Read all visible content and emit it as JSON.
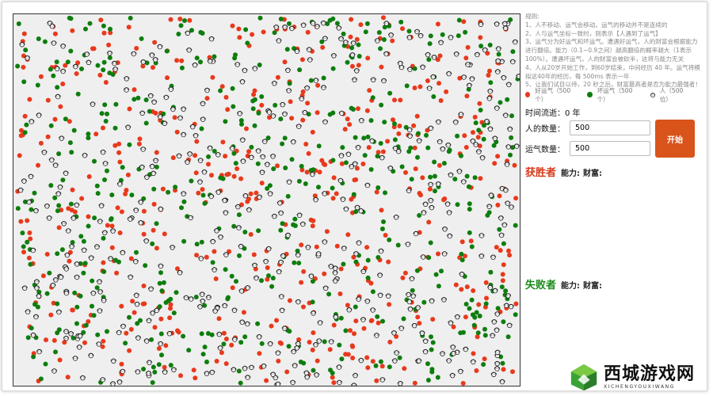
{
  "rules": {
    "title": "规则:",
    "lines": [
      "1、人不移动、运气会移动。运气的移动并不是连续的",
      "2、人与运气坐标一致时，则表示【人遇到了运气】",
      "3、运气分为好运气和坏运气。遭遇好运气，人的财富会根据能力",
      "进行翻倍。能力（0.1~0.9之间）越高翻倍的概率越大（1表示",
      "100%）。遭遇坏运气，人的财富会被砍半，这将与能力无关",
      "4、人从20岁开始工作，到60岁结束，中间经历 40 年。运气将模",
      "拟这40年的经历，每 500ms 表示一年",
      "5、让我们试目以待，20 秒之后，财富最高者是否为能力最强者！"
    ]
  },
  "legend": {
    "good_luck": "好运气（500个）",
    "bad_luck": "坏运气（500个）",
    "people": "人（500位）"
  },
  "colors": {
    "good_luck": "#e8391c",
    "bad_luck": "#0e7d0e",
    "button": "#d9541a",
    "winner": "#d43a1a",
    "loser": "#1a8a1a"
  },
  "time": {
    "label": "时间流逝：",
    "value": "0 年"
  },
  "people_count": {
    "label": "人的数量：",
    "value": "500"
  },
  "luck_count": {
    "label": "运气数量：",
    "value": "500"
  },
  "start_button": "开始",
  "winner": {
    "title": "获胜者",
    "ability": "能力:",
    "wealth": "财富:"
  },
  "loser": {
    "title": "失败者",
    "ability": "能力:",
    "wealth": "财富:"
  },
  "watermark": {
    "cn": "西城游戏网",
    "en": "XICHENGYOUXIWANG"
  }
}
